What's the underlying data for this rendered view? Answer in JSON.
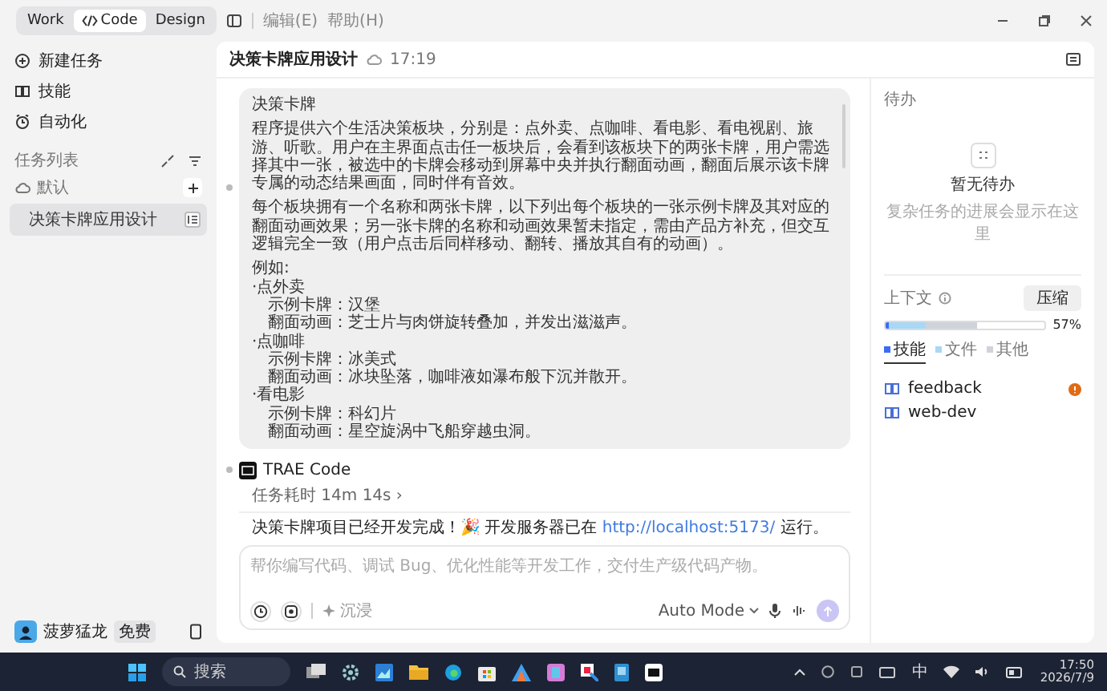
{
  "mode_switch": [
    {
      "label": "Work",
      "selected": false
    },
    {
      "label": "Code",
      "selected": true
    },
    {
      "label": "Design",
      "selected": false
    }
  ],
  "menu": [
    "编辑(E)",
    "帮助(H)"
  ],
  "sidebar": {
    "items": [
      {
        "label": "新建任务",
        "kind": "new"
      },
      {
        "label": "技能",
        "kind": "skills"
      },
      {
        "label": "自动化",
        "kind": "auto"
      }
    ],
    "task_list_title": "任务列表",
    "group": "默认",
    "tasks": [
      {
        "label": "决策卡牌应用设计",
        "selected": true
      }
    ],
    "user": {
      "name": "菠萝猛龙",
      "badge": "免费"
    }
  },
  "header": {
    "title": "决策卡牌应用设计",
    "time": "17:19"
  },
  "bubble": {
    "title": "决策卡牌",
    "paragraphs": [
      "程序提供六个生活决策板块，分别是：点外卖、点咖啡、看电影、看电视剧、旅游、听歌。用户在主界面点击任一板块后，会看到该板块下的两张卡牌，用户需选择其中一张，被选中的卡牌会移动到屏幕中央并执行翻面动画，翻面后展示该卡牌专属的动态结果画面，同时伴有音效。",
      "每个板块拥有一个名称和两张卡牌，以下列出每个板块的一张示例卡牌及其对应的翻面动画效果；另一张卡牌的名称和动画效果暂未指定，需由产品方补充，但交互逻辑完全一致（用户点击后同样移动、翻转、播放其自有的动画）。"
    ],
    "example_label": "例如:",
    "examples": [
      {
        "name": "·点外卖",
        "lines": [
          "示例卡牌：汉堡",
          "翻面动画：芝士片与肉饼旋转叠加，并发出滋滋声。"
        ]
      },
      {
        "name": "·点咖啡",
        "lines": [
          "示例卡牌：冰美式",
          "翻面动画：冰块坠落，咖啡液如瀑布般下沉并散开。"
        ]
      },
      {
        "name": "·看电影",
        "lines": [
          "示例卡牌：科幻片",
          "翻面动画：星空旋涡中飞船穿越虫洞。"
        ]
      }
    ]
  },
  "agent": {
    "name": "TRAE Code",
    "duration": "任务耗时 14m 14s ›",
    "message_before": "决策卡牌项目已经开发完成！🎉 开发服务器已在",
    "link": "http://localhost:5173/",
    "message_after": "运行。"
  },
  "input": {
    "placeholder": "帮你编写代码、调试 Bug、优化性能等开发工作，交付生产级代码产物。",
    "immersive": "沉浸",
    "mode": "Auto Mode"
  },
  "todo": {
    "title": "待办",
    "empty_title": "暂无待办",
    "empty_hint": "复杂任务的进展会显示在这里"
  },
  "context": {
    "title": "上下文",
    "compress": "压缩",
    "percent": "57%",
    "usage": [
      {
        "level": 0.02,
        "color": "#3b6cf6"
      },
      {
        "level": 0.23,
        "color": "#a8d8f5"
      },
      {
        "level": 0.32,
        "color": "#cfd3d9"
      }
    ],
    "tabs": [
      {
        "label": "技能",
        "color": "#3b6cf6",
        "selected": true
      },
      {
        "label": "文件",
        "color": "#a8d8f5",
        "selected": false
      },
      {
        "label": "其他",
        "color": "#cfd3d9",
        "selected": false
      }
    ],
    "items": [
      {
        "label": "feedback",
        "warning": true
      },
      {
        "label": "web-dev",
        "warning": false
      }
    ]
  },
  "taskbar": {
    "search": "搜索",
    "ime": "中",
    "time": "17:50",
    "date": "2026/7/9"
  }
}
